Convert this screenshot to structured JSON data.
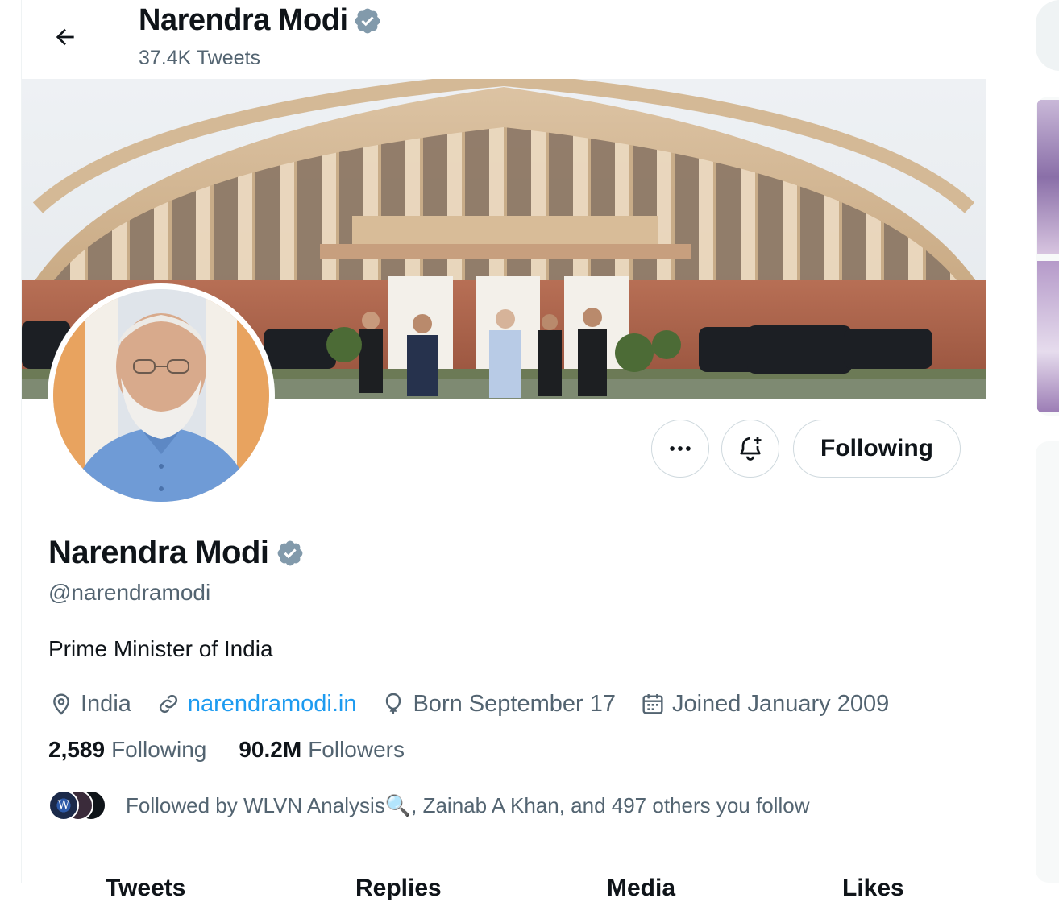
{
  "header": {
    "back_label": "Back",
    "name": "Narendra Modi",
    "tweets_count": "37.4K Tweets"
  },
  "profile": {
    "name": "Narendra Modi",
    "handle": "@narendramodi",
    "bio": "Prime Minister of India",
    "location": "India",
    "website": "narendramodi.in",
    "birthday": "Born September 17",
    "joined": "Joined January 2009",
    "following_count": "2,589",
    "following_label": "Following",
    "followers_count": "90.2M",
    "followers_label": "Followers",
    "followed_by": "Followed by WLVN Analysis🔍, Zainab A Khan, and 497 others you follow",
    "mini_avatar_letter": "W"
  },
  "actions": {
    "follow_state_label": "Following"
  },
  "tabs": [
    {
      "label": "Tweets"
    },
    {
      "label": "Replies"
    },
    {
      "label": "Media"
    },
    {
      "label": "Likes"
    }
  ],
  "colors": {
    "verified": "#829aab",
    "link": "#1d9bf0",
    "secondary_text": "#536471",
    "primary_text": "#0f1419",
    "border": "#cfd9de"
  }
}
